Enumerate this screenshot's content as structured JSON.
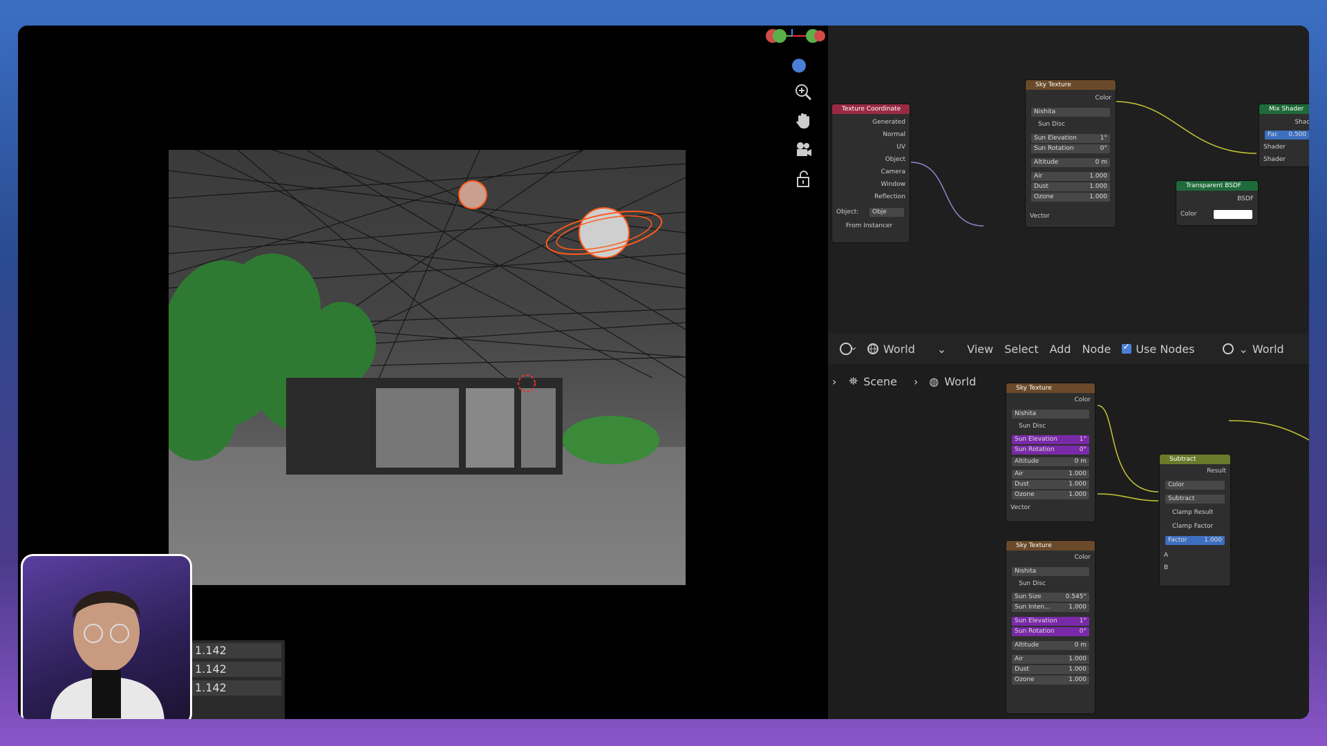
{
  "colors": {
    "accent": "#4a7fd6",
    "sky_header": "#6a4a2a",
    "texcoord_header": "#9a2a44",
    "shader_header": "#1f6a3a",
    "subtract_header": "#6a7a2a",
    "socket_yellow": "#c8c832",
    "socket_purple": "#7a66cc",
    "socket_green": "#35c46a"
  },
  "viewport": {
    "redo_values": [
      "1.142",
      "1.142",
      "1.142"
    ],
    "tools": [
      "zoom-icon",
      "hand-icon",
      "camera-icon",
      "lock-icon"
    ]
  },
  "node_editor_top": {
    "texture_coordinate": {
      "title": "Texture Coordinate",
      "outputs": [
        "Generated",
        "Normal",
        "UV",
        "Object",
        "Camera",
        "Window",
        "Reflection"
      ],
      "object_label": "Object:",
      "object_value": "Obje",
      "from_instancer": "From Instancer"
    },
    "sky_texture": {
      "title": "Sky Texture",
      "output": "Color",
      "type": "Nishita",
      "sun_disc": "Sun Disc",
      "fields": [
        [
          "Sun Elevation",
          "1°"
        ],
        [
          "Sun Rotation",
          "0°"
        ],
        [
          "Altitude",
          "0 m"
        ],
        [
          "Air",
          "1.000"
        ],
        [
          "Dust",
          "1.000"
        ],
        [
          "Ozone",
          "1.000"
        ]
      ],
      "input": "Vector"
    },
    "transparent_bsdf": {
      "title": "Transparent BSDF",
      "output": "BSDF",
      "input": "Color"
    },
    "mix_shader": {
      "title": "Mix Shader",
      "output": "Shad",
      "fac_label": "Fac",
      "fac_value": "0.500",
      "inputs": [
        "Shader",
        "Shader"
      ]
    }
  },
  "header": {
    "world_label": "World",
    "menus": [
      "View",
      "Select",
      "Add",
      "Node"
    ],
    "use_nodes": "Use Nodes",
    "world_right": "World"
  },
  "breadcrumb": {
    "scene": "Scene",
    "world": "World"
  },
  "node_editor_bottom": {
    "sky_a": {
      "title": "Sky Texture",
      "output": "Color",
      "type": "Nishita",
      "sun_disc": "Sun Disc",
      "fields": [
        [
          "Sun Elevation",
          "1°"
        ],
        [
          "Sun Rotation",
          "0°"
        ],
        [
          "Altitude",
          "0 m"
        ],
        [
          "Air",
          "1.000"
        ],
        [
          "Dust",
          "1.000"
        ],
        [
          "Ozone",
          "1.000"
        ]
      ],
      "input": "Vector"
    },
    "sky_b": {
      "title": "Sky Texture",
      "output": "Color",
      "type": "Nishita",
      "sun_disc": "Sun Disc",
      "fields": [
        [
          "Sun Size",
          "0.545°"
        ],
        [
          "Sun Inten...",
          "1.000"
        ],
        [
          "Sun Elevation",
          "1°"
        ],
        [
          "Sun Rotation",
          "0°"
        ],
        [
          "Altitude",
          "0 m"
        ],
        [
          "Air",
          "1.000"
        ],
        [
          "Dust",
          "1.000"
        ],
        [
          "Ozone",
          "1.000"
        ]
      ]
    },
    "subtract": {
      "title": "Subtract",
      "output": "Result",
      "mode": "Color",
      "op": "Subtract",
      "clamp_result": "Clamp Result",
      "clamp_factor": "Clamp Factor",
      "factor_label": "Factor",
      "factor_value": "1.000",
      "inputs": [
        "A",
        "B"
      ]
    }
  }
}
